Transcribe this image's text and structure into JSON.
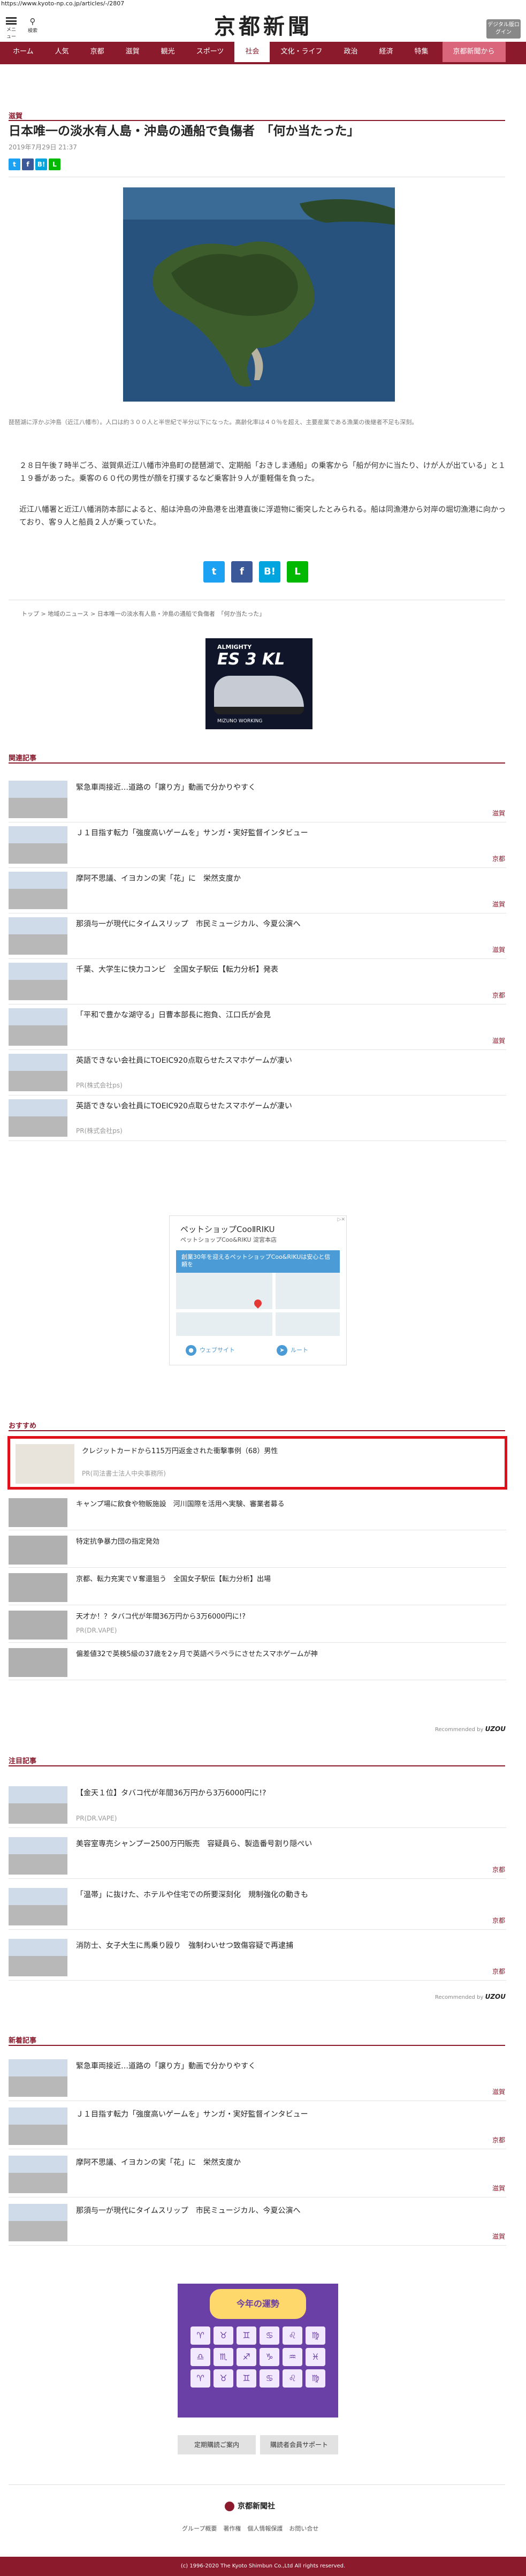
{
  "browser": {
    "url": "https://www.kyoto-np.co.jp/articles/-/2807"
  },
  "header": {
    "menu_label": "メニュー",
    "search_label": "検索",
    "logo": "京都新聞",
    "digital_btn": "デジタル版ログイン"
  },
  "nav": {
    "items": [
      "ホーム",
      "人気",
      "京都",
      "滋賀",
      "観光",
      "スポーツ",
      "社会",
      "文化・ライフ",
      "政治",
      "経済",
      "特集"
    ],
    "active_index": 6,
    "special": "京都新聞から"
  },
  "article": {
    "category": "滋賀",
    "title": "日本唯一の淡水有人島・沖島の通船で負傷者　「何か当たった」",
    "date": "2019年7月29日 21:37",
    "caption": "琵琶湖に浮かぶ沖島（近江八幡市）。人口は約３００人と半世紀で半分以下になった。高齢化率は４０％を超え、主要産業である漁業の後継者不足も深刻。",
    "paragraphs": [
      "２８日午後７時半ごろ、滋賀県近江八幡市沖島町の琵琶湖で、定期船「おきしま通船」の乗客から「船が何かに当たり、けが人が出ている」と１１９番があった。乗客の６０代の男性が顔を打撲するなど乗客計９人が重軽傷を負った。",
      "近江八幡署と近江八幡消防本部によると、船は沖島の沖島港を出港直後に浮遊物に衝突したとみられる。船は同漁港から対岸の堀切漁港に向かっており、客９人と船員２人が乗っていた。"
    ],
    "share_labels": [
      "t",
      "f",
      "B!",
      "L"
    ],
    "breadcrumb": [
      "トップ",
      "地域のニュース",
      "日本唯一の淡水有人島・沖島の通船で負傷者　「何か当たった」"
    ]
  },
  "ads": {
    "shoe_brand": "ALMIGHTY",
    "shoe_model": "ES 3 KL",
    "shoe_footer": "MIZUNO WORKING",
    "map_shop": "ペットショップCooⅡRIKU",
    "map_sub": "ペットショップCoo&RIKU 淀宮本店",
    "map_promo": "創業30年を迎えるペットショップCoo&RIKUは安心と信頼を",
    "map_btn_site": "ウェブサイト",
    "map_btn_route": "ルート",
    "fortune_title": "今年の運勢",
    "fortune_signs": [
      "♈",
      "♉",
      "♊",
      "♋",
      "♌",
      "♍",
      "♎",
      "♏",
      "♐",
      "♑",
      "♒",
      "♓",
      "♈",
      "♉",
      "♊",
      "♋",
      "♌",
      "♍"
    ]
  },
  "related": {
    "heading": "関連記事",
    "items": [
      {
        "title": "緊急車両接近…道路の「譲り方」動画で分かりやすく",
        "region": "滋賀",
        "pr": ""
      },
      {
        "title": "Ｊ１目指す転力「強度高いゲームを」サンガ・実好監督インタビュー",
        "region": "京都",
        "pr": ""
      },
      {
        "title": "摩阿不思議、イヨカンの実「花」に　栄然支度か",
        "region": "滋賀",
        "pr": ""
      },
      {
        "title": "那須与一が現代にタイムスリップ　市民ミュージカル、今夏公演へ",
        "region": "滋賀",
        "pr": ""
      },
      {
        "title": "千葉、大学生に快力コンビ　全国女子駅伝【転力分析】発表",
        "region": "京都",
        "pr": ""
      },
      {
        "title": "「平和で豊かな湖守る」日曹本部長に抱負、江口氏が会見",
        "region": "滋賀",
        "pr": ""
      },
      {
        "title": "英語できない会社員にTOEIC920点取らせたスマホゲームが凄い",
        "region": "",
        "pr": "PR(株式会社ps)"
      },
      {
        "title": "英語できない会社員にTOEIC920点取らせたスマホゲームが凄い",
        "region": "",
        "pr": "PR(株式会社ps)"
      }
    ]
  },
  "recommended": {
    "heading": "おすすめ",
    "items": [
      {
        "title": "クレジットカードから115万円返金された衝撃事例（68）男性",
        "pr": "PR(司法書士法人中央事務所)"
      },
      {
        "title": "キャンプ場に飲食や物販施設　河川国際を活用へ実験、審業者募る",
        "pr": ""
      },
      {
        "title": "特定抗争暴力団の指定発効",
        "pr": ""
      },
      {
        "title": "京都、転力充実でＶ奪還狙う　全国女子駅伝【転力分析】出場",
        "pr": ""
      },
      {
        "title": "天才か！？タバコ代が年間36万円から3万6000円に!?",
        "pr": "PR(DR.VAPE)"
      },
      {
        "title": "偏差値32で英検5級の37歳を2ヶ月で英語ペラペラにさせたスマホゲームが神",
        "pr": ""
      }
    ],
    "powered": "Recommended by",
    "powered_brand": "UZOU"
  },
  "attention": {
    "heading": "注目記事",
    "items": [
      {
        "title": "【金天１位】タバコ代が年間36万円から3万6000円に!?",
        "region": "",
        "pr": "PR(DR.VAPE)"
      },
      {
        "title": "美容室専売シャンプー2500万円販売　容疑員ら、製造番号割り隠ぺい",
        "region": "京都",
        "pr": ""
      },
      {
        "title": "「温帯」に抜けた、ホテルや住宅での所要深刻化　規制強化の動きも",
        "region": "京都",
        "pr": ""
      },
      {
        "title": "消防士、女子大生に馬乗り殴り　強制わいせつ致傷容疑で再逮捕",
        "region": "京都",
        "pr": ""
      }
    ],
    "powered": "Recommended by",
    "powered_brand": "UZOU"
  },
  "latest": {
    "heading": "新着記事",
    "items": [
      {
        "title": "緊急車両接近…道路の「譲り方」動画で分かりやすく",
        "region": "滋賀"
      },
      {
        "title": "Ｊ１目指す転力「強度高いゲームを」サンガ・実好監督インタビュー",
        "region": "京都"
      },
      {
        "title": "摩阿不思議、イヨカンの実「花」に　栄然支度か",
        "region": "滋賀"
      },
      {
        "title": "那須与一が現代にタイムスリップ　市民ミュージカル、今夏公演へ",
        "region": "滋賀"
      }
    ]
  },
  "footer": {
    "buttons": [
      "定期購読ご案内",
      "購読者会員サポート"
    ],
    "company": "京都新聞社",
    "links": [
      "グループ概要",
      "著作権",
      "個人情報保護",
      "お問い合せ"
    ],
    "copyright": "(c) 1996-2020 The Kyoto Shimbun Co.,Ltd All rights reserved."
  }
}
